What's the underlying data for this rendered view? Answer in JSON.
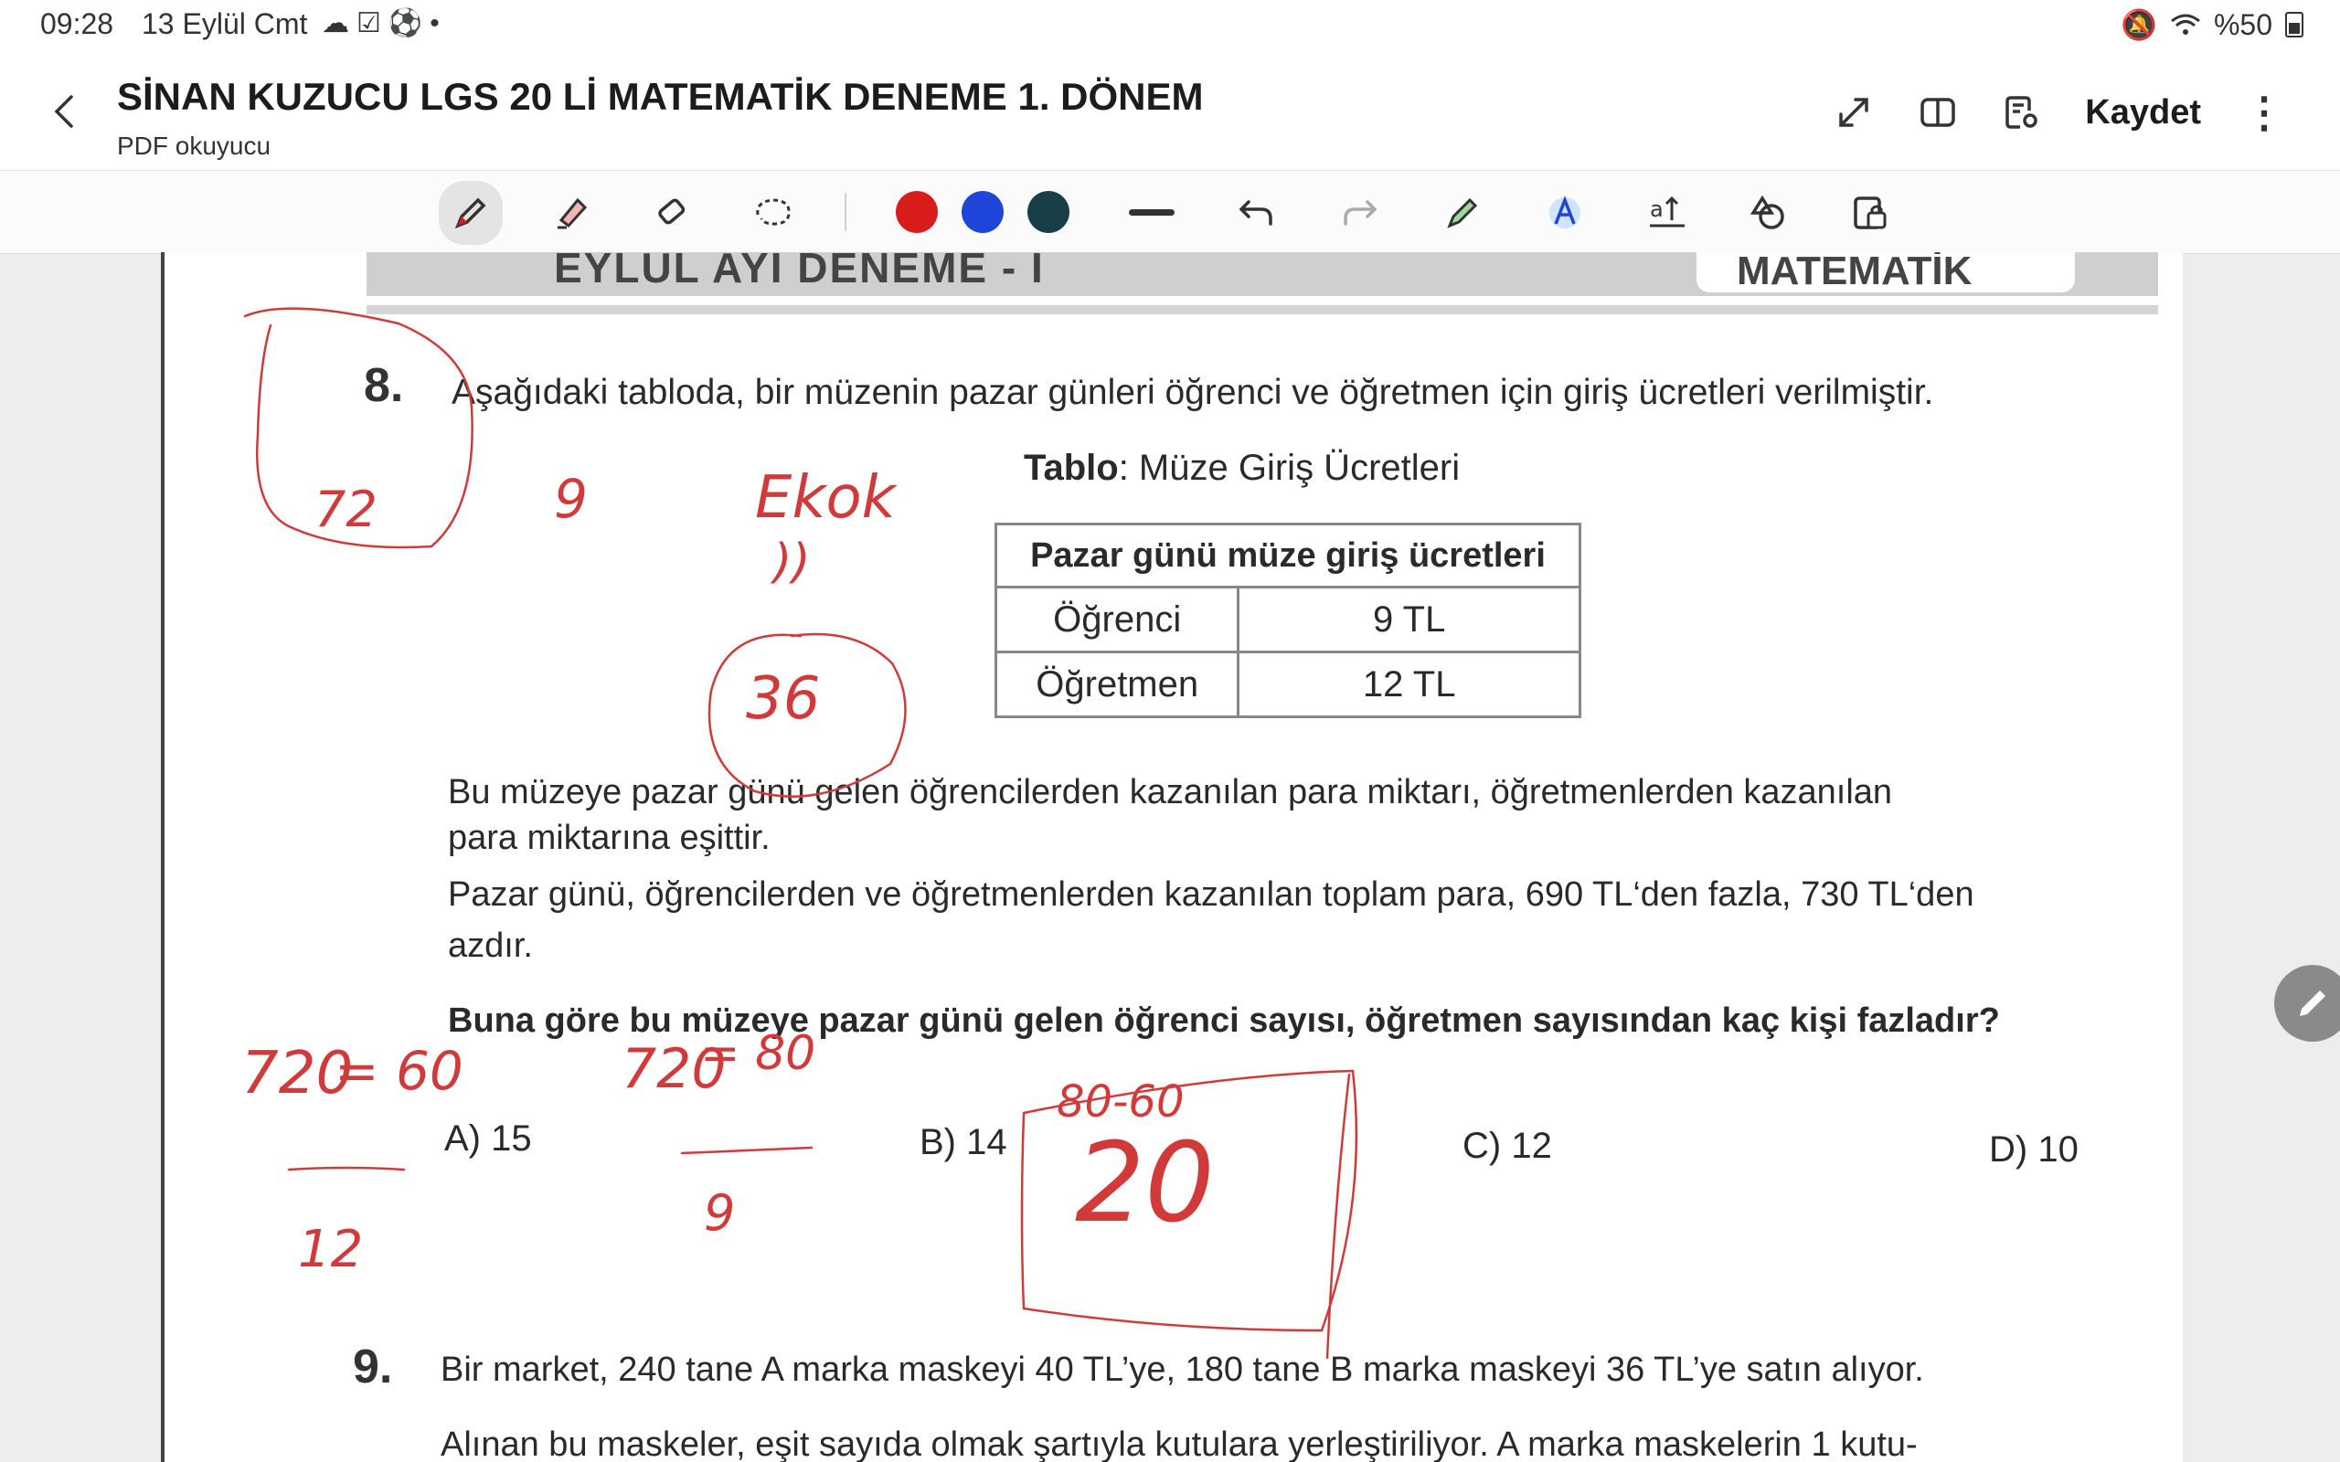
{
  "status_bar": {
    "time": "09:28",
    "date": "13 Eylül Cmt",
    "battery": "%50",
    "icons": [
      "cloud-icon",
      "checkbox-icon",
      "football-icon",
      "dot-icon",
      "mute-icon",
      "wifi-icon",
      "battery-icon"
    ]
  },
  "header": {
    "title": "SİNAN KUZUCU LGS 20 Lİ MATEMATİK DENEME  1. DÖNEM",
    "subtitle": "PDF okuyucu",
    "save_label": "Kaydet",
    "icons": [
      "expand-icon",
      "book-view-icon",
      "document-settings-icon",
      "more-icon"
    ]
  },
  "toolbar": {
    "tools": [
      "pen-icon",
      "highlighter-icon",
      "eraser-icon",
      "lasso-icon",
      "thickness-icon",
      "undo-icon",
      "redo-icon",
      "pen-settings-icon",
      "text-style-icon",
      "text-box-icon",
      "shapes-icon",
      "lock-icon"
    ],
    "colors": [
      "#d81c1c",
      "#1f44d8",
      "#183f47"
    ]
  },
  "page": {
    "banner_text": "EYLÜL AYI DENEME - I",
    "banner_subject": "MATEMATİK",
    "q8": {
      "number": "8.",
      "intro": "Aşağıdaki tabloda, bir müzenin pazar günleri öğrenci ve öğretmen için giriş ücretleri verilmiştir.",
      "caption_bold": "Tablo",
      "caption_rest": ": Müze Giriş Ücretleri",
      "table_header": "Pazar günü müze giriş ücretleri",
      "rows": [
        {
          "label": "Öğrenci",
          "value": "9 TL"
        },
        {
          "label": "Öğretmen",
          "value": "12 TL"
        }
      ],
      "para1_line1": "Bu müzeye pazar günü gelen öğrencilerden kazanılan para miktarı, öğretmenlerden kazanılan",
      "para1_line2": "para miktarına eşittir.",
      "para2_line1": "Pazar günü, öğrencilerden ve öğretmenlerden kazanılan toplam para, 690 TL‘den fazla, 730 TL‘den",
      "para2_line2": "azdır.",
      "question": "Buna göre bu müzeye pazar günü gelen öğrenci sayısı, öğretmen sayısından kaç kişi fazladır?",
      "options": [
        "A) 15",
        "B) 14",
        "C) 12",
        "D) 10"
      ]
    },
    "q9": {
      "number": "9.",
      "line1": "Bir market, 240 tane A marka maskeyi 40 TL’ye, 180 tane B marka maskeyi 36 TL’ye satın alıyor.",
      "line2": "Alınan bu maskeler, eşit sayıda olmak şartıyla kutulara yerleştiriliyor.  A marka maskelerin 1 kutu-"
    },
    "ink_color": "#d23a3a",
    "handwriting": [
      "72",
      "9",
      "Ekok",
      "))",
      "36",
      "720",
      "= 60",
      "12",
      "720",
      "= 80",
      "9",
      "80-60",
      "20"
    ]
  }
}
